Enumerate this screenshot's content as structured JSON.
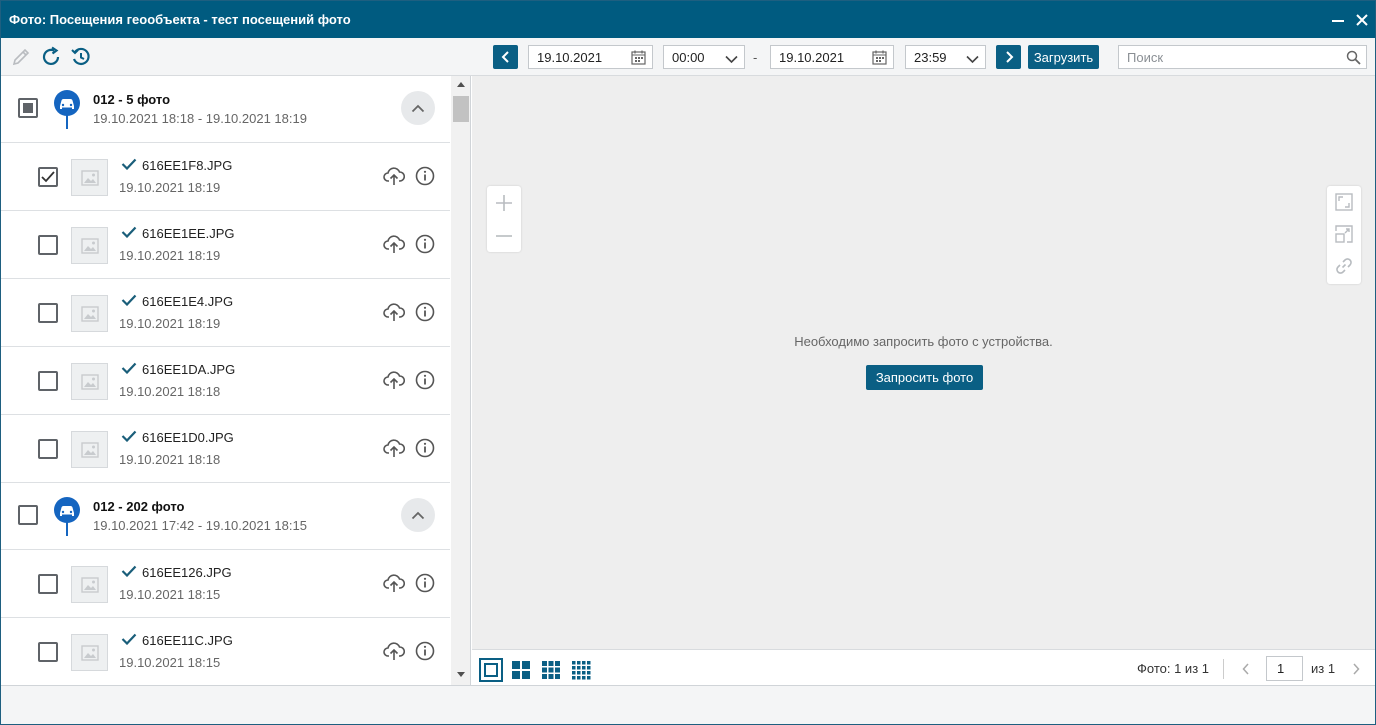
{
  "window": {
    "title": "Фото: Посещения геообъекта - тест посещений фото"
  },
  "toolbar": {
    "date_from": "19.10.2021",
    "time_from": "00:00",
    "separator": "-",
    "date_to": "19.10.2021",
    "time_to": "23:59",
    "load_label": "Загрузить",
    "search_placeholder": "Поиск"
  },
  "groups": [
    {
      "name": "012 - 5 фото",
      "range": "19.10.2021 18:18 - 19.10.2021 18:19",
      "checked": "partial",
      "items": [
        {
          "file": "616EE1F8.JPG",
          "time": "19.10.2021 18:19",
          "checked": true
        },
        {
          "file": "616EE1EE.JPG",
          "time": "19.10.2021 18:19",
          "checked": false
        },
        {
          "file": "616EE1E4.JPG",
          "time": "19.10.2021 18:19",
          "checked": false
        },
        {
          "file": "616EE1DA.JPG",
          "time": "19.10.2021 18:18",
          "checked": false
        },
        {
          "file": "616EE1D0.JPG",
          "time": "19.10.2021 18:18",
          "checked": false
        }
      ]
    },
    {
      "name": "012 - 202 фото",
      "range": "19.10.2021 17:42 - 19.10.2021 18:15",
      "checked": "none",
      "items": [
        {
          "file": "616EE126.JPG",
          "time": "19.10.2021 18:15",
          "checked": false
        },
        {
          "file": "616EE11C.JPG",
          "time": "19.10.2021 18:15",
          "checked": false
        }
      ]
    }
  ],
  "viewer": {
    "message": "Необходимо запросить фото с устройства.",
    "request_label": "Запросить фото"
  },
  "pagination": {
    "photo_count": "Фото: 1 из 1",
    "page": "1",
    "of_pages": "из 1"
  },
  "colors": {
    "accent": "#005b80",
    "button": "#0a5f84",
    "check": "#1a5e7a",
    "pin": "#1565c0"
  }
}
